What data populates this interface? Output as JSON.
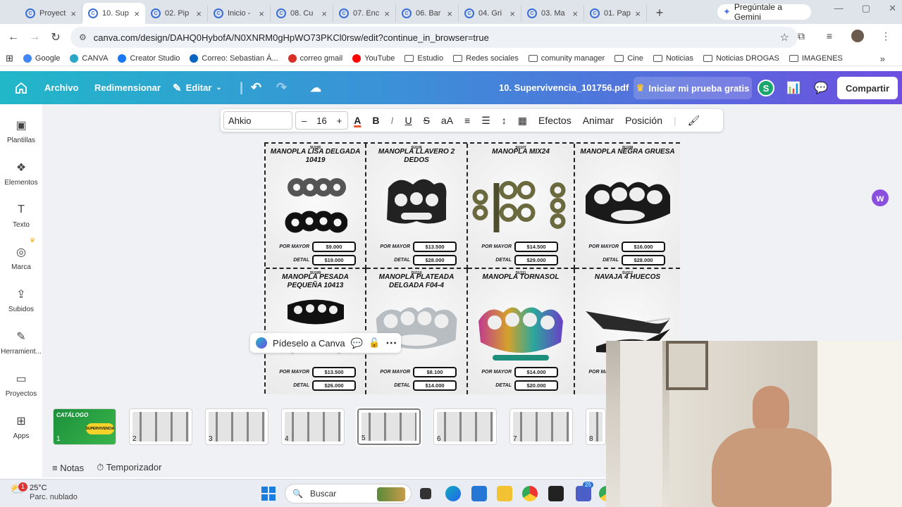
{
  "browser": {
    "tabs": [
      {
        "label": "Proyect",
        "active": false
      },
      {
        "label": "10. Sup",
        "active": true
      },
      {
        "label": "02. Pip",
        "active": false
      },
      {
        "label": "Inicio -",
        "active": false
      },
      {
        "label": "08. Cu",
        "active": false
      },
      {
        "label": "07. Enc",
        "active": false
      },
      {
        "label": "06. Bar",
        "active": false
      },
      {
        "label": "04. Gri",
        "active": false
      },
      {
        "label": "03. Ma",
        "active": false
      },
      {
        "label": "01. Pap",
        "active": false
      }
    ],
    "new_tab": "+",
    "gemini_label": "Pregúntale a Gemini",
    "url": "canva.com/design/DAHQ0HybofA/N0XNRM0gHpWO73PKCl0rsw/edit?continue_in_browser=true",
    "bookmarks": [
      {
        "label": "Google",
        "icon": "google-icon"
      },
      {
        "label": "CANVA",
        "icon": "canva-icon"
      },
      {
        "label": "Creator Studio",
        "icon": "facebook-icon"
      },
      {
        "label": "Correo: Sebastian Á...",
        "icon": "outlook-icon"
      },
      {
        "label": "correo gmail",
        "icon": "gmail-icon"
      },
      {
        "label": "YouTube",
        "icon": "youtube-icon"
      },
      {
        "label": "Estudio",
        "icon": "folder-icon"
      },
      {
        "label": "Redes sociales",
        "icon": "folder-icon"
      },
      {
        "label": "comunity manager",
        "icon": "folder-icon"
      },
      {
        "label": "Cine",
        "icon": "folder-icon"
      },
      {
        "label": "Noticias",
        "icon": "folder-icon"
      },
      {
        "label": "Noticias DROGAS",
        "icon": "folder-icon"
      },
      {
        "label": "IMAGENES",
        "icon": "folder-icon"
      }
    ]
  },
  "canva": {
    "menu": {
      "file": "Archivo",
      "resize": "Redimensionar",
      "edit": "Editar"
    },
    "doc_title": "10. Supervivencia_101756.pdf",
    "trial": "Iniciar mi prueba gratis",
    "avatar_letter": "S",
    "share": "Compartir",
    "sidebar": [
      {
        "label": "Plantillas",
        "icon": "templates-icon"
      },
      {
        "label": "Elementos",
        "icon": "elements-icon"
      },
      {
        "label": "Texto",
        "icon": "text-icon"
      },
      {
        "label": "Marca",
        "icon": "brand-icon"
      },
      {
        "label": "Subidos",
        "icon": "uploads-icon"
      },
      {
        "label": "Herramient...",
        "icon": "tools-icon"
      },
      {
        "label": "Proyectos",
        "icon": "projects-icon"
      },
      {
        "label": "Apps",
        "icon": "apps-icon"
      }
    ],
    "toolbar": {
      "font": "Ahkio",
      "size": "16",
      "minus": "–",
      "plus": "+",
      "effects": "Efectos",
      "animate": "Animar",
      "position": "Posición"
    },
    "ask_canva": "Pídeselo a Canva",
    "notes": "Notas",
    "timer": "Temporizador",
    "colors": {
      "accent": "#21b7c9",
      "brand2": "#6d4fe0"
    }
  },
  "catalog": {
    "wholesale_label": "POR MAYOR",
    "retail_label": "DETAL",
    "products": [
      {
        "code": "SU105",
        "title": "MANOPLA LISA DELGADA 10419",
        "wholesale": "$9.000",
        "retail": "$19.000"
      },
      {
        "code": "SU106",
        "title": "MANOPLA LLAVERO 2 DEDOS",
        "wholesale": "$13.500",
        "retail": "$28.000"
      },
      {
        "code": "SU107",
        "title": "MANOPLA MIX24",
        "wholesale": "$14.500",
        "retail": "$29.000"
      },
      {
        "code": "SU108",
        "title": "MANOPLA NEGRA GRUESA",
        "wholesale": "$16.000",
        "retail": "$28.000"
      },
      {
        "code": "SU109",
        "title": "MANOPLA PESADA PEQUEÑA 10413",
        "wholesale": "$13.500",
        "retail": "$26.000"
      },
      {
        "code": "SU110",
        "title": "MANOPLA PLATEADA DELGADA F04-4",
        "wholesale": "$8.100",
        "retail": "$14.000"
      },
      {
        "code": "SU111",
        "title": "MANOPLA TORNASOL",
        "wholesale": "$14.000",
        "retail": "$20.000"
      },
      {
        "code": "SU112",
        "title": "NAVAJA 4 HUECOS",
        "wholesale": "",
        "retail": ""
      }
    ]
  },
  "pages": [
    {
      "num": "1",
      "cover_title": "CATÁLOGO",
      "cover_badge": "SUPERVIVENCIA"
    },
    {
      "num": "2"
    },
    {
      "num": "3"
    },
    {
      "num": "4"
    },
    {
      "num": "5"
    },
    {
      "num": "6"
    },
    {
      "num": "7"
    },
    {
      "num": "8"
    }
  ],
  "taskbar": {
    "weather_temp": "25°C",
    "weather_desc": "Parc. nublado",
    "weather_badge": "1",
    "search": "Buscar",
    "teams_badge": "25"
  }
}
